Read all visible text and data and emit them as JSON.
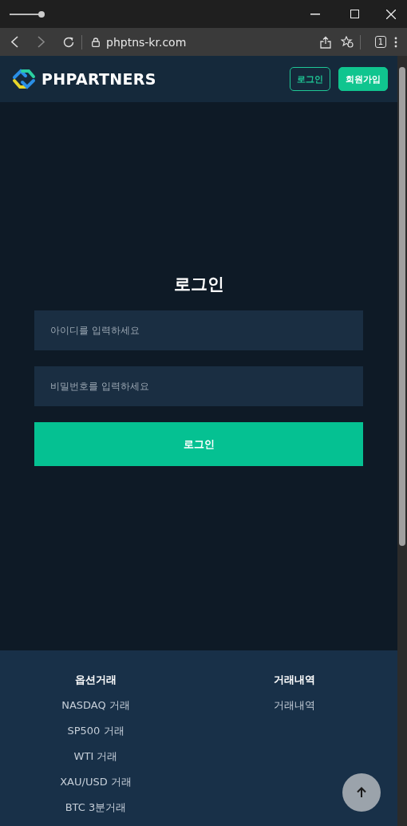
{
  "browser": {
    "url": "phptns-kr.com",
    "tab_count": "1"
  },
  "header": {
    "logo_text": "PHPARTNERS",
    "buttons": [
      {
        "label": "로그인",
        "kind": "outline"
      },
      {
        "label": "회원가입",
        "kind": "filled"
      }
    ]
  },
  "login": {
    "title": "로그인",
    "fields": [
      {
        "placeholder": "아이디를 입력하세요"
      },
      {
        "placeholder": "비밀번호를 입력하세요"
      }
    ],
    "submit": "로그인"
  },
  "footer": {
    "columns": [
      {
        "heading": "옵션거래",
        "links": [
          "NASDAQ 거래",
          "SP500 거래",
          "WTI 거래",
          "XAU/USD 거래",
          "BTC 3분거래"
        ]
      },
      {
        "heading": "거래내역",
        "links": [
          "거래내역"
        ]
      }
    ]
  }
}
